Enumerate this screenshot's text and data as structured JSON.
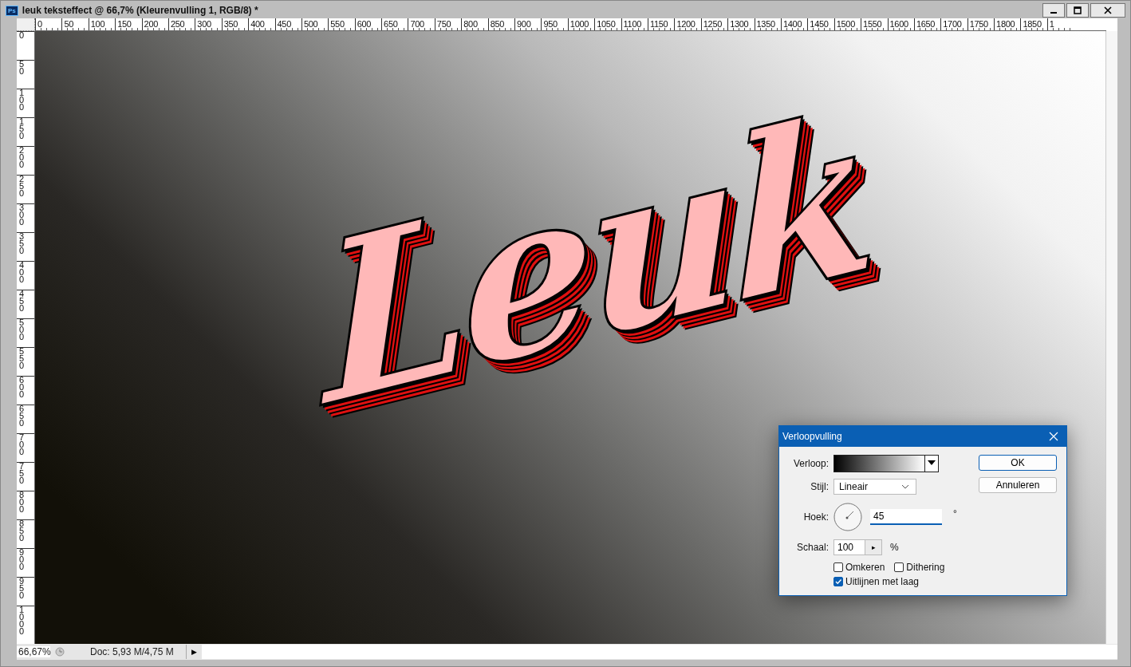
{
  "window": {
    "app_badge": "Ps",
    "title": "leuk teksteffect @ 66,7% (Kleurenvulling 1, RGB/8) *"
  },
  "rulers": {
    "horizontal": [
      "0",
      "50",
      "100",
      "150",
      "200",
      "250",
      "300",
      "350",
      "400",
      "450",
      "500",
      "550",
      "600",
      "650",
      "700",
      "750",
      "800",
      "850",
      "900",
      "950",
      "1000",
      "1050",
      "1100",
      "1150",
      "1200",
      "1250",
      "1300",
      "1350",
      "1400",
      "1450",
      "1500",
      "1550",
      "1600",
      "1650",
      "1700",
      "1750",
      "1800",
      "1850",
      "1"
    ],
    "vertical": [
      "0",
      "50",
      "100",
      "150",
      "200",
      "250",
      "300",
      "350",
      "400",
      "450",
      "500",
      "550",
      "600",
      "650",
      "700",
      "750",
      "800",
      "850",
      "900",
      "950",
      "1000"
    ]
  },
  "canvas": {
    "artwork_text": "Leuk"
  },
  "dialog": {
    "title": "Verloopvulling",
    "gradient_label": "Verloop:",
    "style_label": "Stijl:",
    "style_value": "Lineair",
    "angle_label": "Hoek:",
    "angle_value": "45",
    "angle_unit": "°",
    "scale_label": "Schaal:",
    "scale_value": "100",
    "scale_arrow": "▸",
    "scale_unit": "%",
    "checkboxes": [
      {
        "label": "Omkeren",
        "checked": false
      },
      {
        "label": "Dithering",
        "checked": false
      },
      {
        "label": "Uitlijnen met laag",
        "checked": true
      }
    ],
    "buttons": [
      {
        "label": "OK",
        "default": true
      },
      {
        "label": "Annuleren",
        "default": false
      }
    ]
  },
  "status_bar": {
    "zoom": "66,67%",
    "doc_info": "Doc: 5,93 M/4,75 M",
    "arrow": "▶"
  }
}
